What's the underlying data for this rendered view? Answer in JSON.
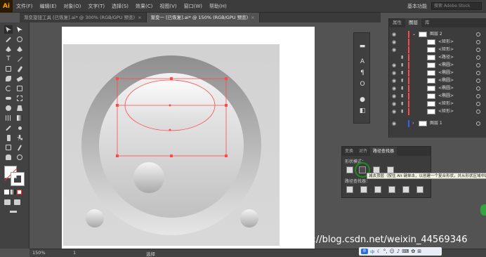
{
  "app": {
    "logo": "Ai"
  },
  "menu": [
    "文件(F)",
    "编辑(E)",
    "对象(O)",
    "文字(T)",
    "选择(S)",
    "效果(C)",
    "视图(V)",
    "窗口(W)",
    "帮助(H)"
  ],
  "workspace": {
    "label": "基本功能",
    "search_placeholder": "搜索 Adobe Stock"
  },
  "tabs": [
    {
      "label": "渐变旋钮工具 [已恢复].ai* @ 300% (RGB/GPU 预览)",
      "active": false
    },
    {
      "label": "渐变一 [已恢复].ai* @ 150% (RGB/GPU 预览)",
      "active": true
    }
  ],
  "status": {
    "zoom": "150%",
    "page": "1",
    "mode": "选择"
  },
  "layers_panel": {
    "tabs": [
      "属性",
      "图层",
      "库"
    ],
    "active_tab": "图层",
    "rows": [
      {
        "name": "图层 2",
        "kind": "layer"
      },
      {
        "name": "<矩形>",
        "kind": "item"
      },
      {
        "name": "<矩形>",
        "kind": "item"
      },
      {
        "name": "<路径>",
        "kind": "item"
      },
      {
        "name": "<椭圆>",
        "kind": "item"
      },
      {
        "name": "<椭圆>",
        "kind": "item"
      },
      {
        "name": "<椭圆>",
        "kind": "item"
      },
      {
        "name": "<椭圆>",
        "kind": "item"
      },
      {
        "name": "<椭圆>",
        "kind": "item"
      },
      {
        "name": "<矩形>",
        "kind": "item"
      },
      {
        "name": "<矩形>",
        "kind": "item"
      },
      {
        "name": "图层 1",
        "kind": "layer"
      }
    ]
  },
  "pathfinder": {
    "tabs": [
      "变换",
      "对齐",
      "路径查找器"
    ],
    "active_tab": "路径查找器",
    "shape_modes_label": "形状模式：",
    "pathfinders_label": "路径查找器：",
    "tooltip": "减去顶层（按住 Alt 键单击，以创建一个复合形状，并从形状区域中减去）"
  },
  "watermark": "https://blog.csdn.net/weixin_44569346",
  "ime": {
    "badge": "中",
    "text": "中"
  },
  "colors": {
    "accent": "#ff9a00",
    "highlight": "#1d8d1d",
    "selection": "#ff4a4a"
  }
}
